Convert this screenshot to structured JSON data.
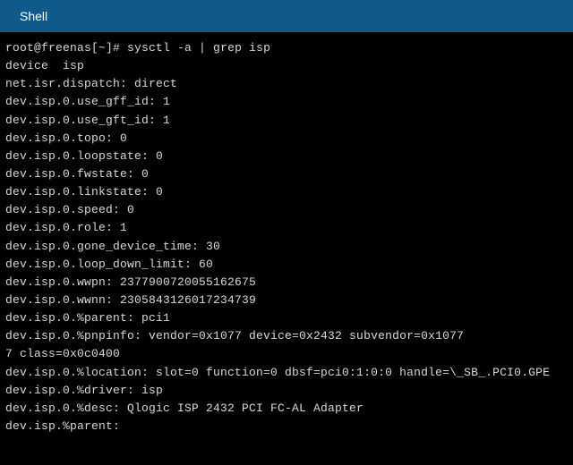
{
  "header": {
    "title": "Shell"
  },
  "terminal": {
    "prompt": "root@freenas[~]#",
    "command": "sysctl -a | grep isp",
    "lines": [
      "device  isp",
      "net.isr.dispatch: direct",
      "dev.isp.0.use_gff_id: 1",
      "dev.isp.0.use_gft_id: 1",
      "dev.isp.0.topo: 0",
      "dev.isp.0.loopstate: 0",
      "dev.isp.0.fwstate: 0",
      "dev.isp.0.linkstate: 0",
      "dev.isp.0.speed: 0",
      "dev.isp.0.role: 1",
      "dev.isp.0.gone_device_time: 30",
      "dev.isp.0.loop_down_limit: 60",
      "dev.isp.0.wwpn: 2377900720055162675",
      "dev.isp.0.wwnn: 2305843126017234739",
      "dev.isp.0.%parent: pci1",
      "dev.isp.0.%pnpinfo: vendor=0x1077 device=0x2432 subvendor=0x1077",
      "7 class=0x0c0400",
      "dev.isp.0.%location: slot=0 function=0 dbsf=pci0:1:0:0 handle=\\_SB_.PCI0.GPE",
      "dev.isp.0.%driver: isp",
      "dev.isp.0.%desc: Qlogic ISP 2432 PCI FC-AL Adapter",
      "dev.isp.%parent:"
    ]
  }
}
